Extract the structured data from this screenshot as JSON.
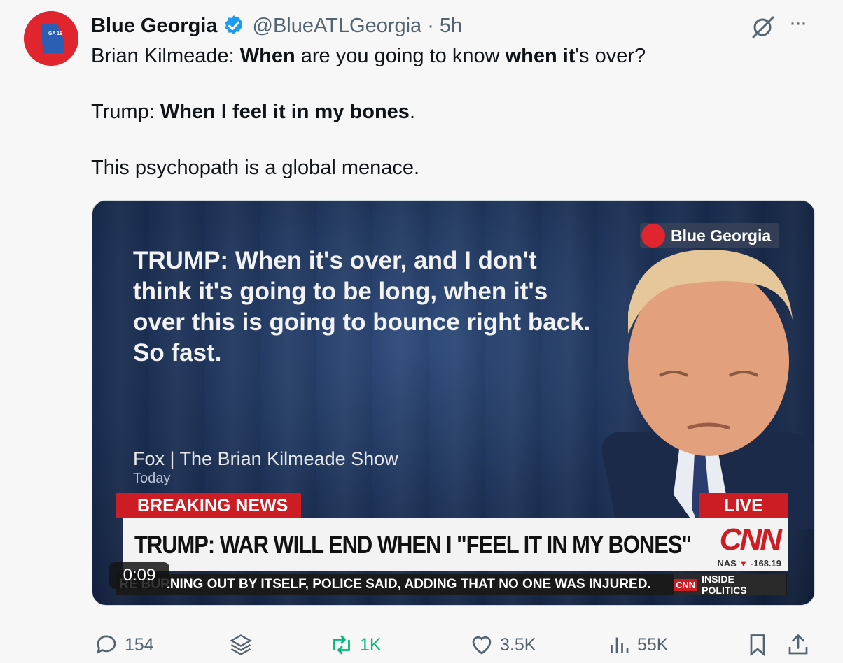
{
  "author": {
    "display_name": "Blue Georgia",
    "handle": "@BlueATLGeorgia",
    "separator": "·",
    "time": "5h",
    "avatar_label": "GA 16"
  },
  "tweet": {
    "line1_pre": "Brian Kilmeade: ",
    "line1_b1": "When",
    "line1_mid": " are you going to know ",
    "line1_b2": "when it",
    "line1_post": "'s over?",
    "line2_pre": "Trump: ",
    "line2_b": "When I feel it in my bones",
    "line2_post": ".",
    "line3": "This psychopath is a global menace."
  },
  "media": {
    "quote": "TRUMP: When it's over, and I don't think it's going to be long, when it's over this is going to bounce right back. So fast.",
    "source": "Fox | The Brian Kilmeade Show",
    "source_date": "Today",
    "watermark": "Blue Georgia",
    "breaking": "BREAKING NEWS",
    "live": "LIVE",
    "headline": "TRUMP: WAR WILL END WHEN I \"FEEL IT IN MY BONES\"",
    "network": "CNN",
    "stock_label": "NAS",
    "stock_value": "-168.19",
    "ticker": "RE BURNING OUT BY ITSELF, POLICE SAID, ADDING THAT NO ONE WAS INJURED.",
    "show_network": "CNN",
    "show_name": "INSIDE POLITICS",
    "duration": "0:09"
  },
  "actions": {
    "replies": "154",
    "retweets": "1K",
    "likes": "3.5K",
    "views": "55K"
  },
  "colors": {
    "verified": "#1d9bf0",
    "retweet_green": "#00ba7c",
    "cnn_red": "#cc1d24",
    "secondary_text": "#536471"
  },
  "icons": [
    "verified-badge-icon",
    "grok-icon",
    "more-icon",
    "reply-icon",
    "layers-icon",
    "retweet-icon",
    "like-icon",
    "views-icon",
    "bookmark-icon",
    "share-icon"
  ]
}
